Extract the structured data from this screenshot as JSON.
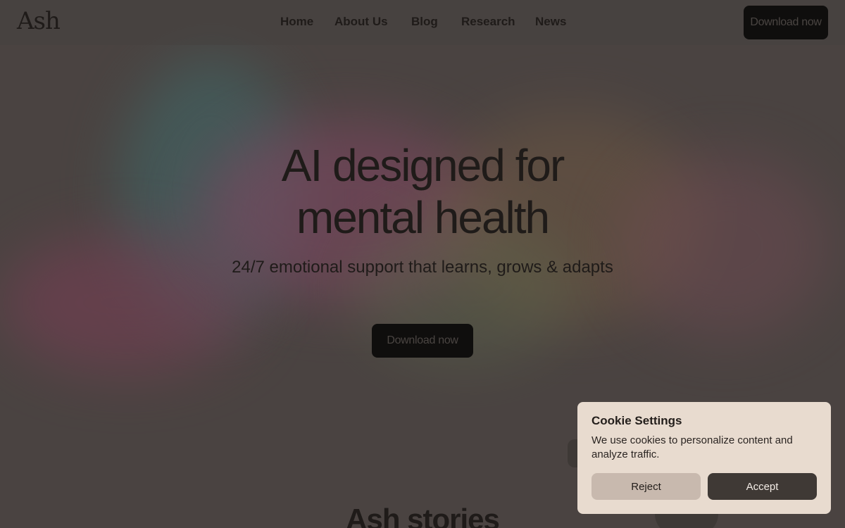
{
  "header": {
    "logo": "Ash",
    "nav": [
      "Home",
      "About Us",
      "Blog",
      "Research",
      "News"
    ],
    "cta_label": "Download now"
  },
  "hero": {
    "title_line1": "AI designed for",
    "title_line2": "mental health",
    "subtitle": "24/7 emotional support that learns, grows & adapts",
    "cta_label": "Download now"
  },
  "stories": {
    "title": "Ash stories"
  },
  "cookie": {
    "title": "Cookie Settings",
    "text": "We use cookies to personalize content and analyze traffic.",
    "reject_label": "Reject",
    "accept_label": "Accept"
  },
  "colors": {
    "overlay_bg": "#4a4341",
    "dark_button": "#0f0e0d",
    "cookie_bg": "#e8dbcf",
    "reject_bg": "#c8b9ae",
    "accept_bg": "#3f3935"
  }
}
